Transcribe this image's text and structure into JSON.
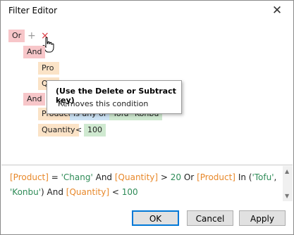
{
  "window": {
    "title": "Filter Editor",
    "close_icon": "close-icon"
  },
  "tree": {
    "root_group": "Or",
    "add_glyph": "+",
    "delete_glyph": "×",
    "group1": {
      "label": "And",
      "rows": [
        {
          "field": "Pro"
        },
        {
          "field": "Qu"
        }
      ]
    },
    "group2": {
      "label": "And",
      "rows": [
        {
          "field": "Product",
          "operator": "Is any of",
          "values": [
            "Tofu",
            "Konbu"
          ]
        },
        {
          "field": "Quantity",
          "operator": "<",
          "value": "100"
        }
      ]
    }
  },
  "tooltip": {
    "title": "(Use the Delete or Subtract key)",
    "body": "Removes this condition"
  },
  "expression": {
    "p1": "[Product]",
    "t1": " = ",
    "v1": "'Chang'",
    "t2": " And ",
    "p2": "[Quantity]",
    "t3": " > ",
    "v2": "20",
    "t4": " Or ",
    "p3": "[Product]",
    "t5": " In (",
    "v3": "'Tofu'",
    "t6": ", ",
    "v4": "'Konbu'",
    "t7": ") And ",
    "p4": "[Quantity]",
    "t8": " < ",
    "v5": "100"
  },
  "buttons": {
    "ok": "OK",
    "cancel": "Cancel",
    "apply": "Apply"
  },
  "colors": {
    "group": "#f7c6c9",
    "field": "#fbe3c7",
    "operator": "#cde3f5",
    "value": "#cfe9d0",
    "delete": "#d9363e"
  }
}
